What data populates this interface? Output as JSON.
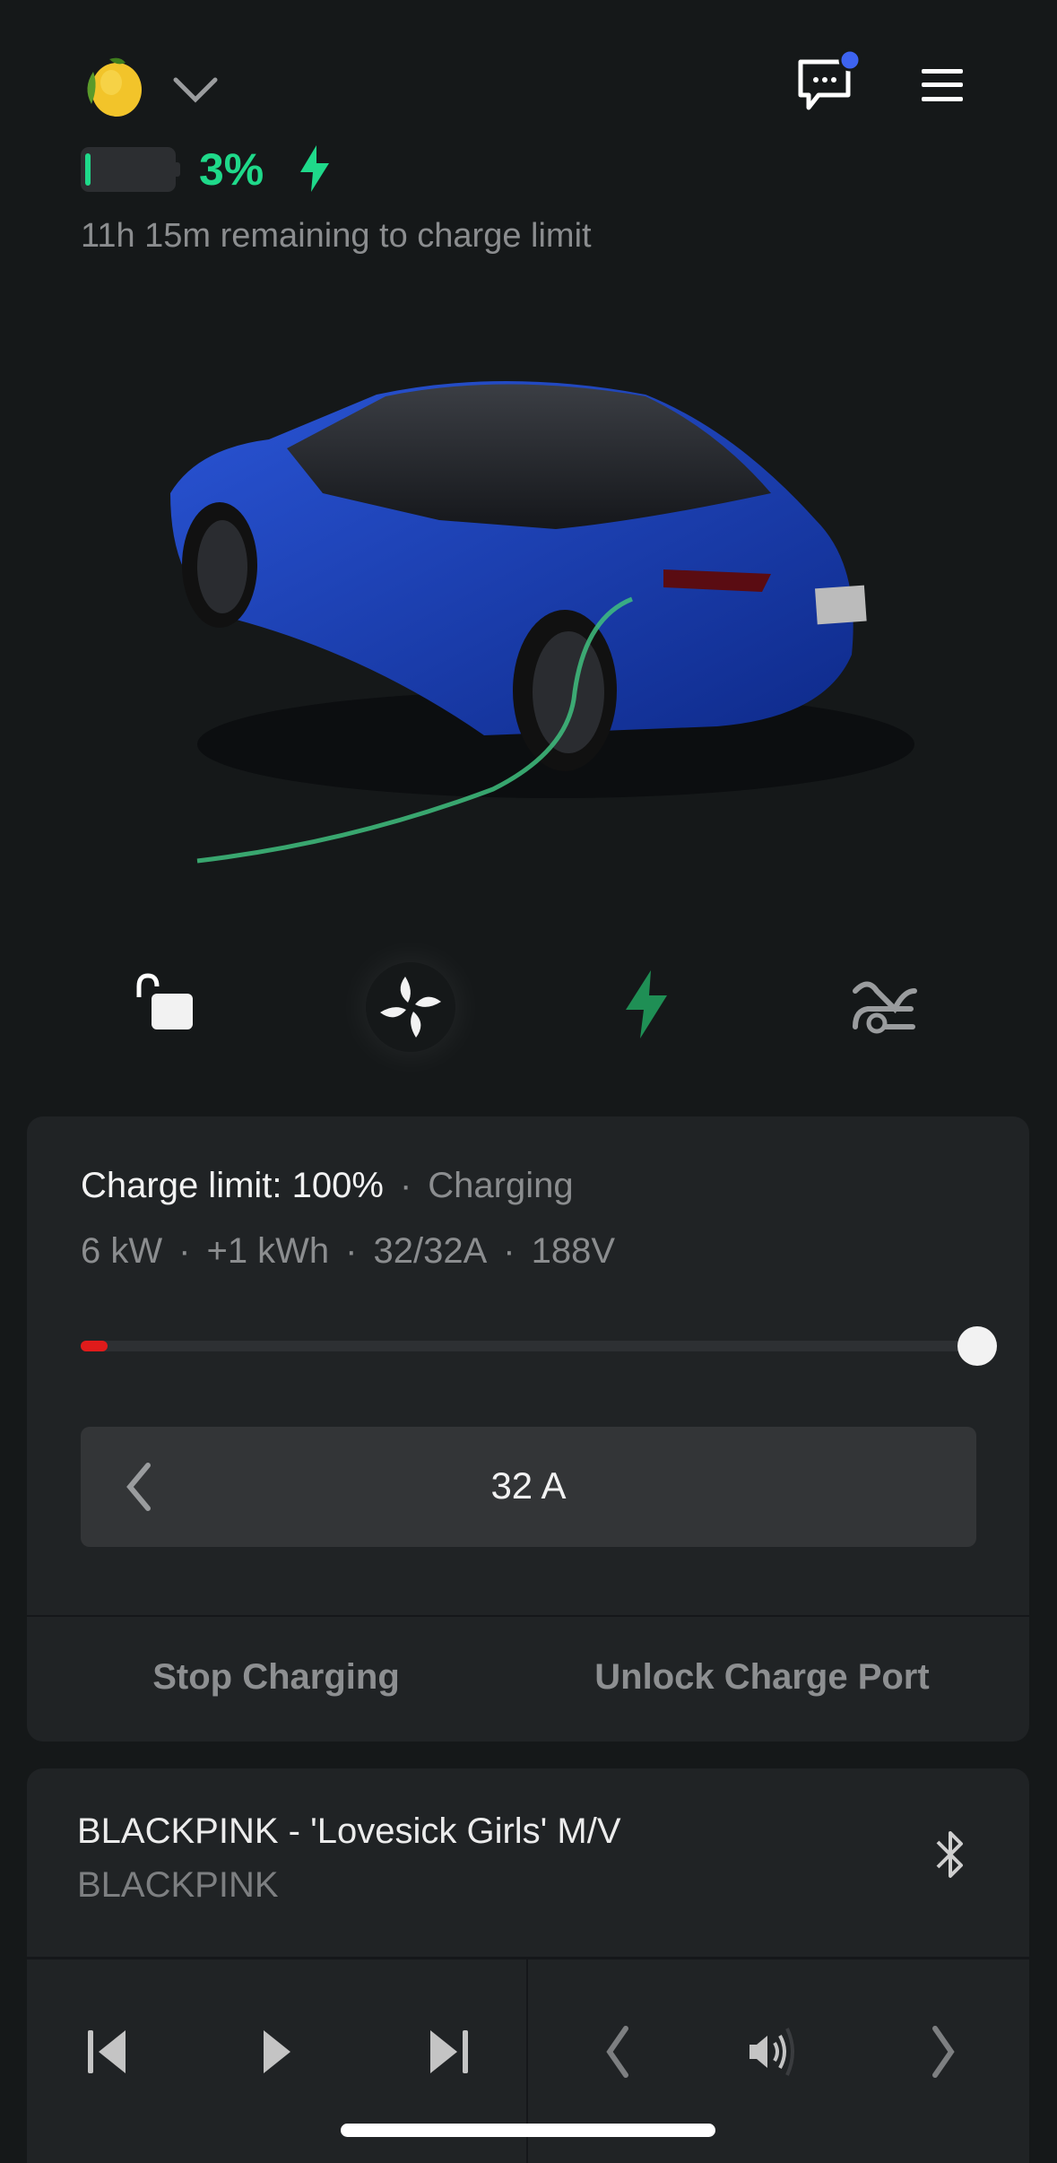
{
  "header": {
    "profile_icon": "lemon-emoji",
    "dropdown_icon": "chevron-down-icon",
    "messages_icon": "chat-bubble-icon",
    "notification_color": "#3d63f0",
    "menu_icon": "hamburger-menu-icon"
  },
  "battery": {
    "level_percent": 3,
    "percent_label": "3%",
    "charging": true,
    "accent_color": "#1fd98a",
    "remaining_text": "11h 15m remaining to charge limit"
  },
  "quick_controls": [
    {
      "name": "lock",
      "icon": "unlocked-padlock-icon"
    },
    {
      "name": "climate",
      "icon": "fan-icon"
    },
    {
      "name": "charging",
      "icon": "lightning-bolt-icon"
    },
    {
      "name": "summon",
      "icon": "car-remote-icon"
    }
  ],
  "charging_card": {
    "limit_label": "Charge limit: 100%",
    "status": "Charging",
    "stats": [
      "6 kW",
      "+1 kWh",
      "32/32A",
      "188V"
    ],
    "charge_level_percent": 3,
    "charge_limit_percent": 100,
    "amps_value": "32 A",
    "stop_button": "Stop Charging",
    "unlock_port_button": "Unlock Charge Port"
  },
  "media_card": {
    "title": "BLACKPINK - 'Lovesick Girls' M/V",
    "artist": "BLACKPINK",
    "source_icon": "bluetooth-icon"
  }
}
